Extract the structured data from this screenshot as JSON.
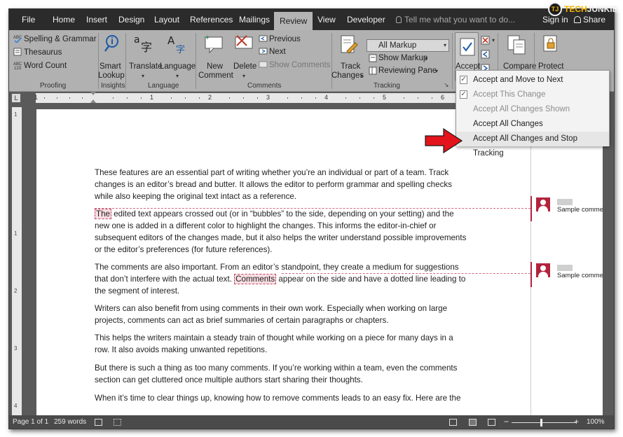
{
  "brand": {
    "badge": "TJ",
    "name_a": "TECH",
    "name_b": "JUNKIE"
  },
  "tabs": [
    "File",
    "Home",
    "Insert",
    "Design",
    "Layout",
    "References",
    "Mailings",
    "Review",
    "View",
    "Developer"
  ],
  "active_tab": "Review",
  "tell_me": "Tell me what you want to do...",
  "sign_in": "Sign in",
  "share": "Share",
  "ribbon": {
    "proofing": {
      "spelling": "Spelling & Grammar",
      "thesaurus": "Thesaurus",
      "word_count": "Word Count",
      "group": "Proofing"
    },
    "insights": {
      "smart": "Smart",
      "lookup": "Lookup",
      "group": "Insights"
    },
    "language": {
      "translate": "Translate",
      "language": "Language",
      "group": "Language"
    },
    "comments": {
      "new1": "New",
      "new2": "Comment",
      "delete": "Delete",
      "previous": "Previous",
      "next": "Next",
      "show": "Show Comments",
      "group": "Comments"
    },
    "tracking": {
      "track1": "Track",
      "track2": "Changes",
      "markup_mode": "All Markup",
      "show_markup": "Show Markup",
      "reviewing_pane": "Reviewing Pane",
      "group": "Tracking"
    },
    "changes": {
      "accept": "Accept"
    },
    "compare": {
      "label": "Compare"
    },
    "protect": {
      "label": "Protect"
    }
  },
  "accept_menu": [
    {
      "label": "Accept and Move to Next",
      "enabled": true
    },
    {
      "label": "Accept This Change",
      "enabled": false
    },
    {
      "label": "Accept All Changes Shown",
      "enabled": false
    },
    {
      "label": "Accept All Changes",
      "enabled": true
    },
    {
      "label": "Accept All Changes and Stop Tracking",
      "enabled": true,
      "hovered": true
    }
  ],
  "ruler_numbers": [
    "1",
    "1",
    "2",
    "3",
    "4",
    "5",
    "6"
  ],
  "vruler_numbers": [
    "1",
    "1",
    "2",
    "3",
    "4"
  ],
  "document": {
    "p1": [
      "These features are an essential part of writing whether you’re an individual or part of a team. Track",
      "changes is an editor’s bread and butter. It allows the editor to perform grammar and spelling checks",
      "while also keeping the original text intact as a reference."
    ],
    "p2_first_hl": "The",
    "p2_first_rest": " edited text appears crossed out (or in “bubbles” to the side, depending on your setting) and the",
    "p2": [
      "new one is added in a different color to highlight the changes. This informs the editor-in-chief or",
      "subsequent editors of the changes made, but it also helps the writer understand possible improvements",
      "or the editor’s preferences (for future references)."
    ],
    "p3_line1": "The comments are also important. From an editor’s standpoint, they create a medium for suggestions",
    "p3_l2_pre": "that don’t interfere with the actual text. ",
    "p3_l2_hl": "Comments",
    "p3_l2_post": " appear on the side and have a dotted line leading to",
    "p3_line3": "the segment of interest.",
    "p4": [
      "Writers can also benefit from using comments in their own work. Especially when working on large",
      "projects, comments can act as brief summaries of certain paragraphs or chapters."
    ],
    "p5": [
      "This helps the writers maintain a steady train of thought while working on a piece for many days in a",
      "row. It also avoids making unwanted repetitions."
    ],
    "p6": [
      "But there is such a thing as too many comments. If you’re working within a team, even the comments",
      "section can get cluttered once multiple authors start sharing their thoughts."
    ],
    "p7": [
      "When it’s time to clear things up, knowing how to remove comments leads to an easy fix. Here are the"
    ]
  },
  "comments": [
    {
      "text": "Sample comment"
    },
    {
      "text": "Sample comment"
    }
  ],
  "status": {
    "page": "Page 1 of 1",
    "words": "259 words",
    "zoom": "100%",
    "zoom_minus": "−",
    "zoom_plus": "+"
  },
  "zoom_level_fraction": 0.5,
  "colors": {
    "accent": "#b2233c",
    "tab_bar": "#2b2b2b",
    "ribbon": "#b1b1b1",
    "arrow": "#e3141b"
  }
}
